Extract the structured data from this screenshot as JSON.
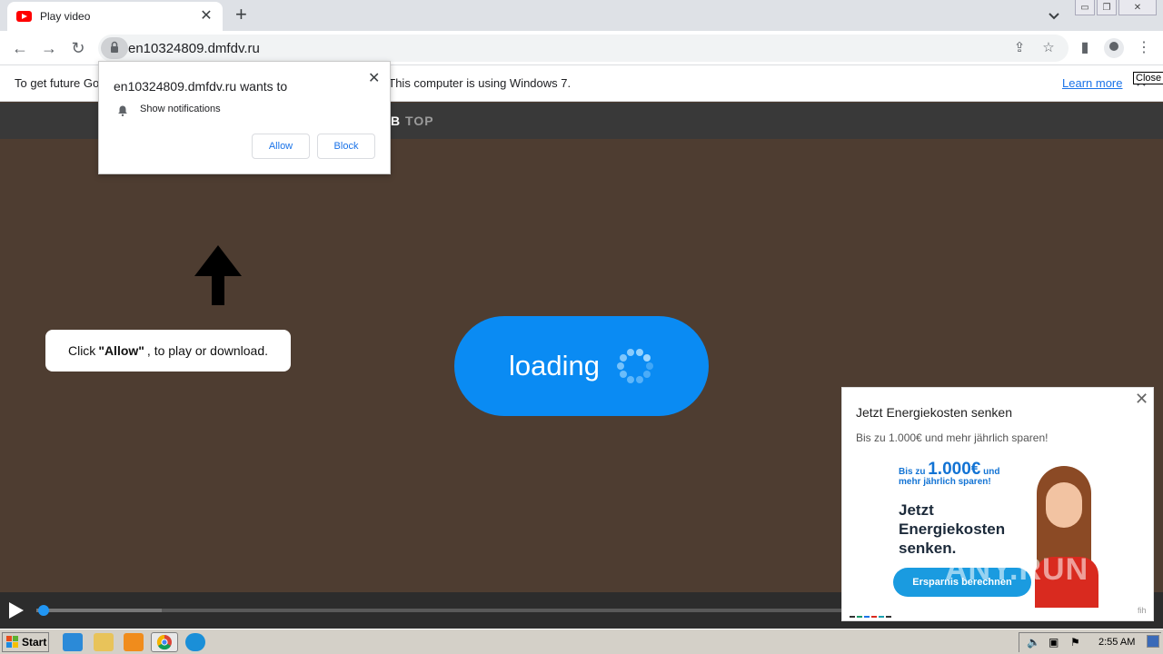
{
  "browser": {
    "tab_title": "Play video",
    "url": "en10324809.dmfdv.ru"
  },
  "infobar": {
    "message": "To get future Google Chrome updates, you'll need Windows 10 or later. This computer is using Windows 7.",
    "learn_more": "Learn more",
    "close_tooltip": "Close"
  },
  "permission": {
    "title": "en10324809.dmfdv.ru wants to",
    "item": "Show notifications",
    "allow": "Allow",
    "block": "Block"
  },
  "site": {
    "brand_bold": "B",
    "brand_light": "TOP",
    "hint_prefix": "Click",
    "hint_bold": "\"Allow\"",
    "hint_suffix": ", to play or download.",
    "loading": "loading"
  },
  "player": {
    "progress_fraction": 0.0
  },
  "ad": {
    "title": "Jetzt Energiekosten senken",
    "subtitle": "Bis zu 1.000€ und mehr jährlich sparen!",
    "promo_small": "Bis zu",
    "promo_amount": "1.000€",
    "promo_rest": "und mehr jährlich sparen!",
    "headline": "Jetzt Energiekosten senken.",
    "cta": "Ersparnis berechnen",
    "footer": "fih"
  },
  "watermark": "ANY.RUN",
  "taskbar": {
    "start": "Start",
    "clock": "2:55 AM"
  },
  "colors": {
    "page_bg": "#4e3d31",
    "loading_pill": "#0a8bf3",
    "accent_link": "#1a73e8"
  }
}
